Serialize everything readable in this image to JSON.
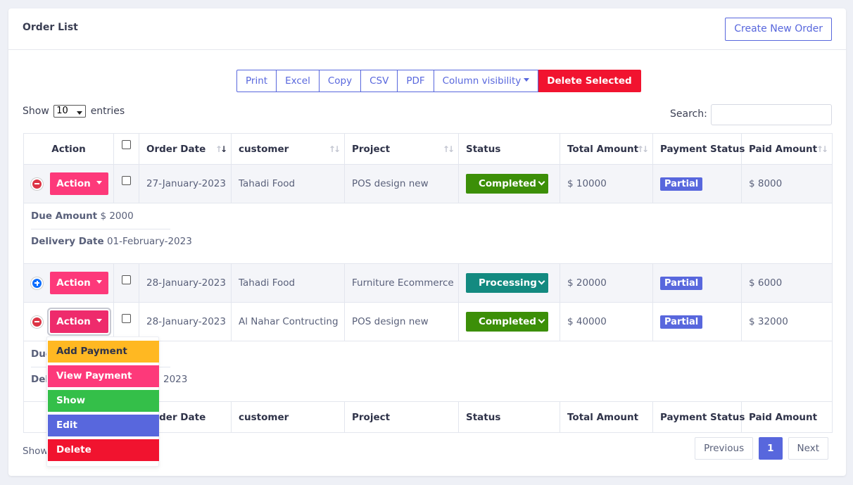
{
  "header": {
    "title": "Order List",
    "create_button": "Create New Order"
  },
  "buttons": {
    "print": "Print",
    "excel": "Excel",
    "copy": "Copy",
    "csv": "CSV",
    "pdf": "PDF",
    "column_visibility": "Column visibility",
    "delete_selected": "Delete Selected"
  },
  "length": {
    "prefix": "Show",
    "value": "10",
    "suffix": "entries"
  },
  "search": {
    "label": "Search:",
    "value": ""
  },
  "columns": [
    "Action",
    "",
    "Order Date",
    "customer",
    "Project",
    "Status",
    "Total Amount",
    "Payment Status",
    "Paid Amount"
  ],
  "rows": [
    {
      "action": "Action",
      "date": "27-January-2023",
      "customer": "Tahadi Food",
      "project": "POS design new",
      "status": "Completed",
      "total": "$ 10000",
      "payment_status": "Partial",
      "paid": "$ 8000",
      "expanded": true
    },
    {
      "action": "Action",
      "date": "28-January-2023",
      "customer": "Tahadi Food",
      "project": "Furniture Ecommerce",
      "status": "Processing",
      "total": "$ 20000",
      "payment_status": "Partial",
      "paid": "$ 6000",
      "expanded": false
    },
    {
      "action": "Action",
      "date": "28-January-2023",
      "customer": "Al Nahar Contructing",
      "project": "POS design new",
      "status": "Completed",
      "total": "$ 40000",
      "payment_status": "Partial",
      "paid": "$ 32000",
      "expanded": true
    }
  ],
  "child1": {
    "due_label": "Due Amount",
    "due_value": "$ 2000",
    "delivery_label": "Delivery Date",
    "delivery_value": "01-February-2023"
  },
  "child3": {
    "due_label": "Due",
    "delivery_label": "Del",
    "delivery_value_tail": "2023"
  },
  "footer_columns": [
    "",
    "Order Date",
    "customer",
    "Project",
    "Status",
    "Total Amount",
    "Payment Status",
    "Paid Amount"
  ],
  "dropdown": [
    "Add Payment",
    "View Payment",
    "Show",
    "Edit",
    "Delete"
  ],
  "info": "Show",
  "pagination": {
    "previous": "Previous",
    "current": "1",
    "next": "Next"
  },
  "colors": {
    "primary": "#5867dd",
    "action": "#fd397a",
    "completed": "#3c8f08",
    "processing": "#138a80",
    "danger": "#f1132f",
    "add_payment": "#ffb822",
    "show": "#34bf49"
  }
}
